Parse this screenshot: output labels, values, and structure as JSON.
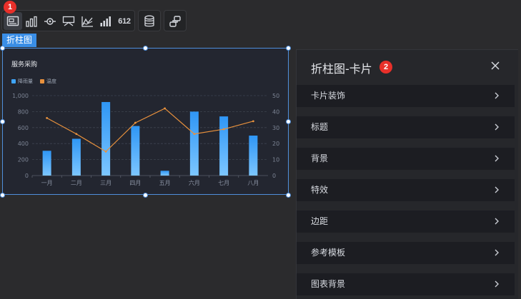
{
  "toolbar": {
    "badge": "1",
    "group1": [
      "chart-card-icon",
      "bar-chart-icon",
      "eye-target-icon",
      "board-icon",
      "line-chart-icon",
      "column-chart-icon",
      "number-icon"
    ],
    "number_icon_text": "612",
    "group2": [
      "database-icon"
    ],
    "group3": [
      "link-icon"
    ]
  },
  "selected_tag": "折柱图",
  "card": {
    "title": "服务采购"
  },
  "chart_data": {
    "type": "bar",
    "title": "服务采购",
    "categories": [
      "一月",
      "二月",
      "三月",
      "四月",
      "五月",
      "六月",
      "七月",
      "八月"
    ],
    "series": [
      {
        "name": "降雨量",
        "type": "bar",
        "axis": "left",
        "values": [
          310,
          460,
          920,
          620,
          60,
          800,
          740,
          500
        ],
        "color": "#3fa4f8"
      },
      {
        "name": "温度",
        "type": "line",
        "axis": "right",
        "values": [
          36,
          26,
          15,
          33,
          42,
          26,
          29,
          34
        ],
        "color": "#e8913d"
      }
    ],
    "y_left": {
      "ylim": [
        0,
        1000
      ],
      "ticks": [
        "0",
        "200",
        "400",
        "600",
        "800",
        "1,000"
      ]
    },
    "y_right": {
      "ylim": [
        0,
        50
      ],
      "ticks": [
        "0",
        "10",
        "20",
        "30",
        "40",
        "50"
      ]
    },
    "grid": true,
    "legend_position": "top-left"
  },
  "panel": {
    "title": "折柱图-卡片",
    "badge": "2",
    "rows": [
      {
        "label": "卡片装饰"
      },
      {
        "label": "标题"
      },
      {
        "label": "背景"
      },
      {
        "label": "特效"
      },
      {
        "label": "边距"
      },
      {
        "label": "参考模板"
      },
      {
        "label": "图表背景"
      }
    ]
  }
}
